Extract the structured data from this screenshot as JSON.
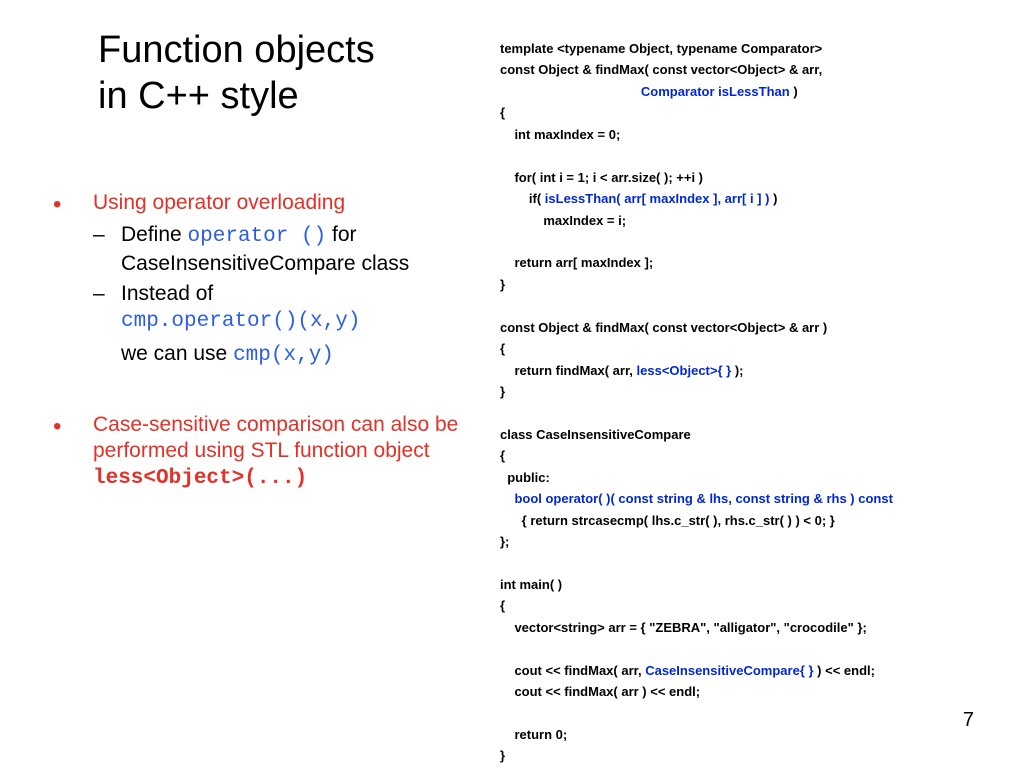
{
  "title_line1": "Function objects",
  "title_line2": "in C++ style",
  "bullet1": "Using operator overloading",
  "sub1a_pre": "Define ",
  "sub1a_code": "operator ()",
  "sub1a_post": " for CaseInsensitiveCompare  class",
  "sub1b_pre": "Instead of ",
  "sub1b_code": "cmp.operator()(x,y)",
  "sub1b_post1": "we can use  ",
  "sub1b_post2": "cmp(x,y)",
  "bullet2_line1": "Case-sensitive comparison can also be performed using STL function object ",
  "bullet2_code": "less<Object>(...)",
  "code": {
    "l1": "template <typename Object, typename Comparator>",
    "l2": "const Object & findMax( const vector<Object> & arr,",
    "l3_indent": "                                       ",
    "l3_kw": "Comparator isLessThan",
    "l3_end": " )",
    "l4": "{",
    "l5": "    int maxIndex = 0;",
    "l6": "",
    "l7": "    for( int i = 1; i < arr.size( ); ++i )",
    "l8_pre": "        if( ",
    "l8_kw": "isLessThan( arr[ maxIndex ], arr[ i ] )",
    "l8_end": " )",
    "l9": "            maxIndex = i;",
    "l10": "",
    "l11": "    return arr[ maxIndex ];",
    "l12": "}",
    "l13": "",
    "l14": "const Object & findMax( const vector<Object> & arr )",
    "l15": "{",
    "l16_pre": "    return findMax( arr, ",
    "l16_kw": "less<Object>{ }",
    "l16_end": " );",
    "l17": "}",
    "l18": "",
    "l19": "class CaseInsensitiveCompare",
    "l20": "{",
    "l21": "  public:",
    "l22_kw": "    bool operator( )( const string & lhs, const string & rhs ) const",
    "l23": "      { return strcasecmp( lhs.c_str( ), rhs.c_str( ) ) < 0; }",
    "l24": "};",
    "l25": "",
    "l26": "int main( )",
    "l27": "{",
    "l28": "    vector<string> arr = { \"ZEBRA\", \"alligator\", \"crocodile\" };",
    "l29": "",
    "l30_pre": "    cout << findMax( arr, ",
    "l30_kw": "CaseInsensitiveCompare{ }",
    "l30_end": " ) << endl;",
    "l31": "    cout << findMax( arr ) << endl;",
    "l32": "",
    "l33": "    return 0;",
    "l34": "}"
  },
  "page": "7"
}
